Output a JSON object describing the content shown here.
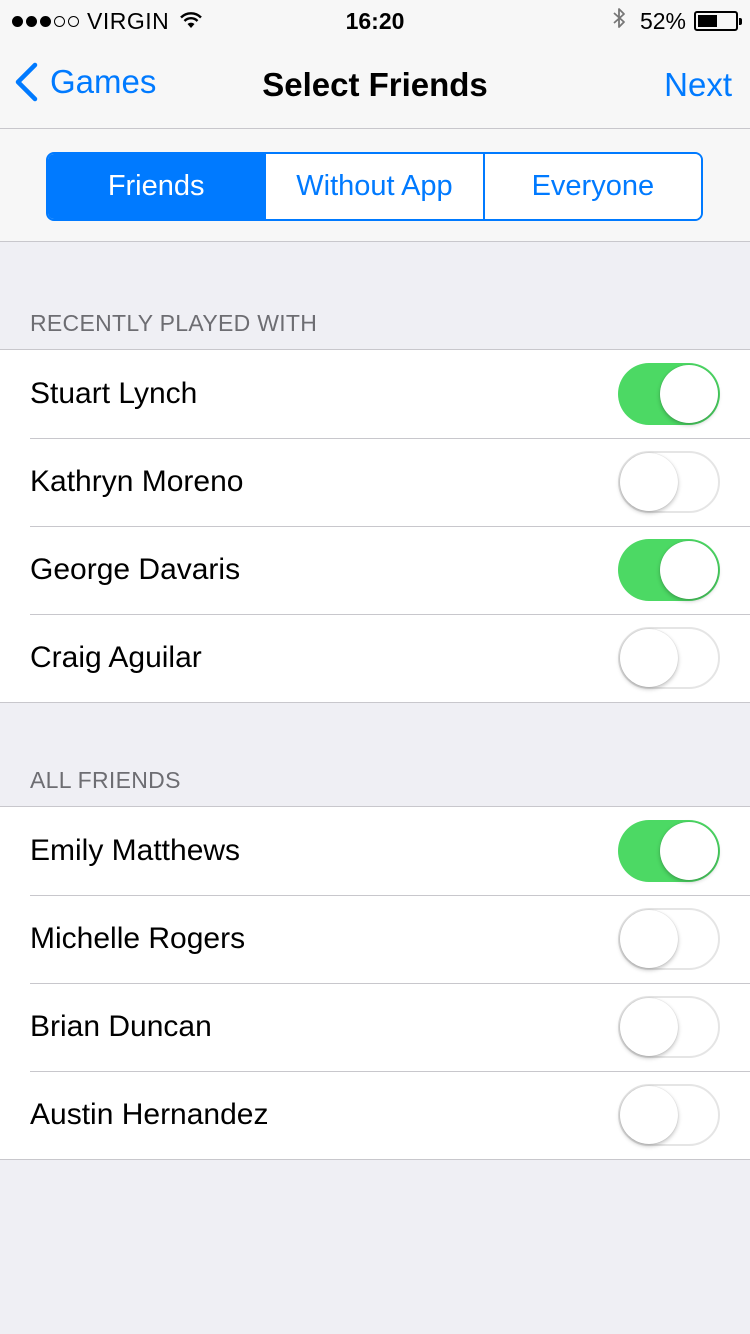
{
  "status_bar": {
    "signal_dots": [
      true,
      true,
      true,
      false,
      false
    ],
    "carrier": "VIRGIN",
    "time": "16:20",
    "battery_text": "52%",
    "battery_level": 0.52
  },
  "nav": {
    "back_label": "Games",
    "title": "Select Friends",
    "next_label": "Next"
  },
  "segments": [
    {
      "label": "Friends",
      "selected": true
    },
    {
      "label": "Without App",
      "selected": false
    },
    {
      "label": "Everyone",
      "selected": false
    }
  ],
  "sections": [
    {
      "header": "RECENTLY PLAYED WITH",
      "rows": [
        {
          "name": "Stuart Lynch",
          "on": true
        },
        {
          "name": "Kathryn Moreno",
          "on": false
        },
        {
          "name": "George Davaris",
          "on": true
        },
        {
          "name": "Craig Aguilar",
          "on": false
        }
      ]
    },
    {
      "header": "ALL FRIENDS",
      "rows": [
        {
          "name": "Emily Matthews",
          "on": true
        },
        {
          "name": "Michelle Rogers",
          "on": false
        },
        {
          "name": "Brian Duncan",
          "on": false
        },
        {
          "name": "Austin Hernandez",
          "on": false
        }
      ]
    }
  ],
  "colors": {
    "tint": "#007aff",
    "switch_on": "#4cd964",
    "background": "#efeff4"
  }
}
